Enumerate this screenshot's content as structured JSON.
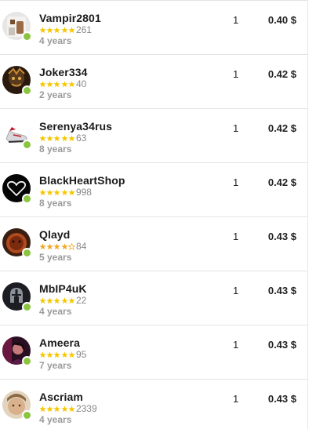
{
  "sellers": [
    {
      "name": "Vampir2801",
      "stars": 5,
      "reviews": "261",
      "age": "4 years",
      "qty": "1",
      "price": "0.40 $",
      "avatar_icon": "user-photo-icon"
    },
    {
      "name": "Joker334",
      "stars": 5,
      "reviews": "40",
      "age": "2 years",
      "qty": "1",
      "price": "0.42 $",
      "avatar_icon": "user-photo-icon"
    },
    {
      "name": "Serenya34rus",
      "stars": 5,
      "reviews": "63",
      "age": "8 years",
      "qty": "1",
      "price": "0.42 $",
      "avatar_icon": "sneaker-icon"
    },
    {
      "name": "BlackHeartShop",
      "stars": 5,
      "reviews": "998",
      "age": "8 years",
      "qty": "1",
      "price": "0.42 $",
      "avatar_icon": "heart-icon"
    },
    {
      "name": "Qlayd",
      "stars": 4,
      "reviews": "84",
      "age": "5 years",
      "qty": "1",
      "price": "0.43 $",
      "avatar_icon": "user-photo-icon"
    },
    {
      "name": "MbIP4uK",
      "stars": 5,
      "reviews": "22",
      "age": "4 years",
      "qty": "1",
      "price": "0.43 $",
      "avatar_icon": "helmet-icon"
    },
    {
      "name": "Ameera",
      "stars": 5,
      "reviews": "95",
      "age": "7 years",
      "qty": "1",
      "price": "0.43 $",
      "avatar_icon": "user-photo-icon"
    },
    {
      "name": "Ascriam",
      "stars": 5,
      "reviews": "2339",
      "age": "4 years",
      "qty": "1",
      "price": "0.43 $",
      "avatar_icon": "user-photo-icon"
    }
  ],
  "colors": {
    "online": "#8bc53f",
    "star_full": "#f7c600",
    "star_four": "#f5a623",
    "divider": "#e3e3e3"
  }
}
